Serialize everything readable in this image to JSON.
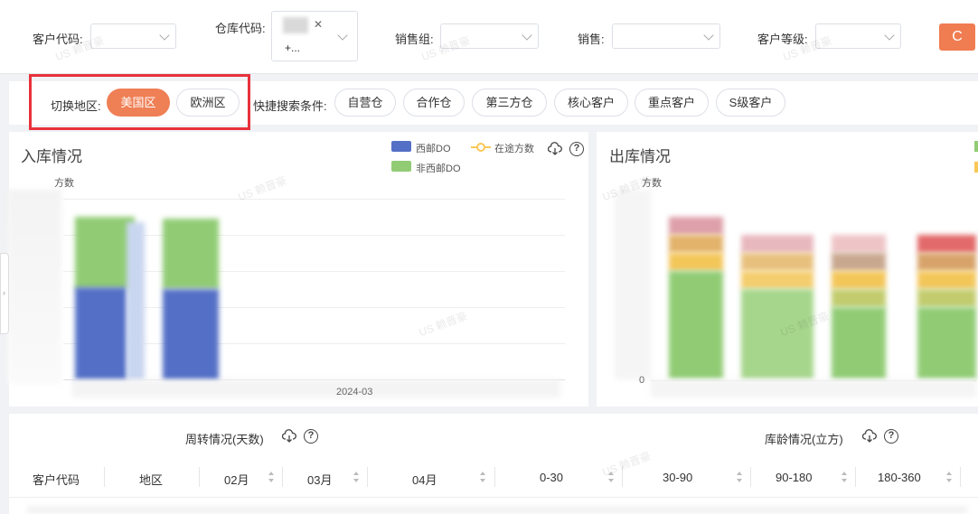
{
  "filters": {
    "customer_code_label": "客户代码:",
    "warehouse_code_label": "仓库代码:",
    "warehouse_tag_more": "+...",
    "sales_group_label": "销售组:",
    "sales_label": "销售:",
    "customer_level_label": "客户等级:",
    "refresh_icon": "C"
  },
  "quick": {
    "region_label": "切换地区:",
    "regions": [
      {
        "label": "美国区",
        "active": true
      },
      {
        "label": "欧洲区",
        "active": false
      }
    ],
    "search_label": "快捷搜索条件:",
    "chips": [
      "自营仓",
      "合作仓",
      "第三方仓",
      "核心客户",
      "重点客户",
      "S级客户"
    ]
  },
  "inbound": {
    "title": "入库情况",
    "unit_label": "方数",
    "legend": [
      {
        "label": "西邮DO",
        "color": "#5470c6"
      },
      {
        "label": "在途方数",
        "color": "#fac858"
      },
      {
        "label": "非西邮DO",
        "color": "#91cc75"
      }
    ],
    "x_tick": "2024-03"
  },
  "outbound": {
    "title": "出库情况",
    "unit_label": "方数",
    "zero_tick": "0"
  },
  "table": {
    "turnover_title": "周转情况(天数)",
    "inventory_age_title": "库龄情况(立方)",
    "columns": [
      "客户代码",
      "地区",
      "02月",
      "03月",
      "04月",
      "0-30",
      "30-90",
      "90-180",
      "180-360"
    ]
  },
  "watermark": "US 赖晋豪",
  "colors": {
    "accent": "#ef7f55",
    "highlight_frame": "#e8323c",
    "series_blue": "#5470c6",
    "series_green": "#91cc75",
    "series_yellow": "#fac858",
    "series_red": "#ee6666"
  },
  "icons": {
    "download": "cloud-download-icon",
    "help": "question-circle-icon"
  }
}
